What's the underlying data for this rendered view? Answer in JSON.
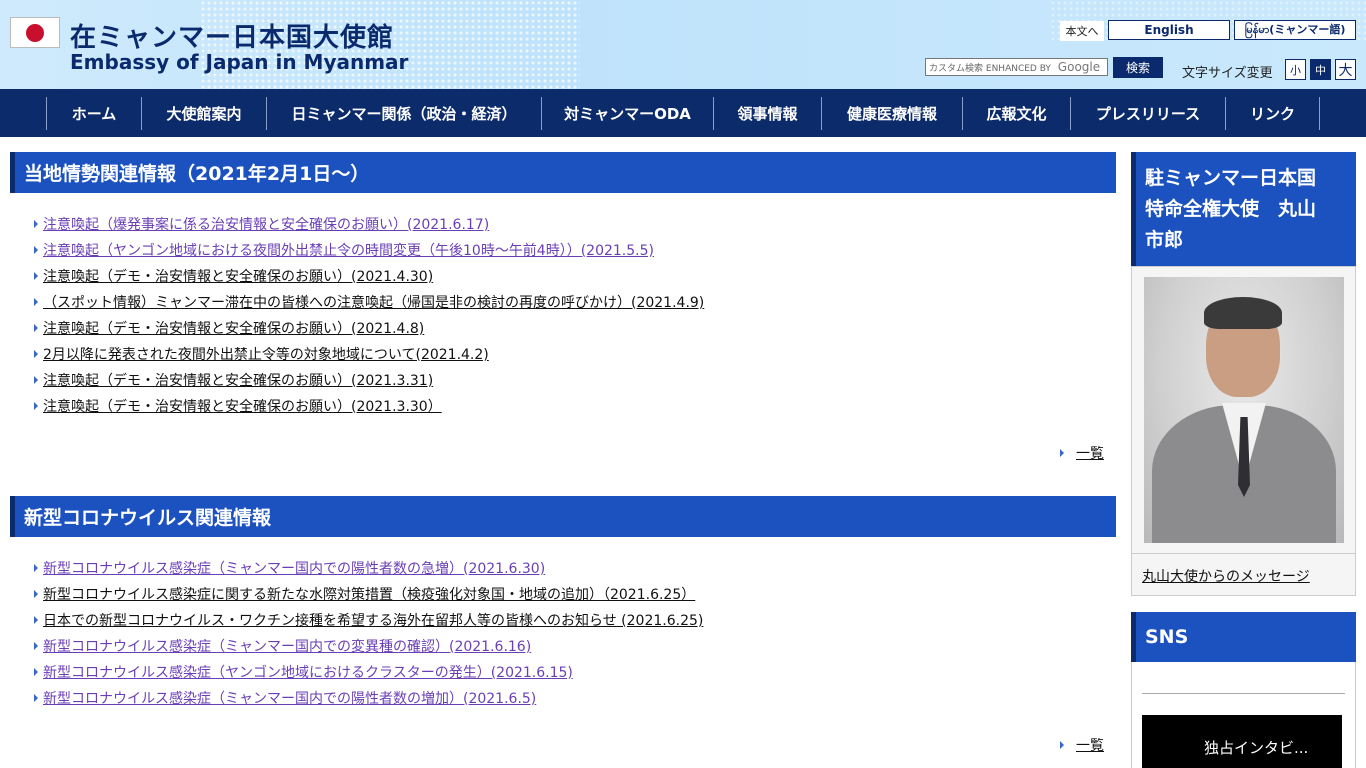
{
  "header": {
    "title_ja": "在ミャンマー日本国大使館",
    "title_en": "Embassy of Japan in Myanmar",
    "skip_link": "本文へ",
    "lang_english": "English",
    "lang_myanmar": "မြန်မာ(ミャンマー語)",
    "search_placeholder": "カスタム検索",
    "search_powered": "ENHANCED BY",
    "search_google": "Google",
    "search_button": "検索",
    "font_size_label": "文字サイズ変更",
    "font_small": "小",
    "font_medium": "中",
    "font_large": "大"
  },
  "nav": [
    "ホーム",
    "大使館案内",
    "日ミャンマー関係（政治・経済）",
    "対ミャンマーODA",
    "領事情報",
    "健康医療情報",
    "広報文化",
    "プレスリリース",
    "リンク"
  ],
  "section1": {
    "title": "当地情勢関連情報（2021年2月1日～）",
    "items": [
      "注意喚起（爆発事案に係る治安情報と安全確保のお願い）(2021.6.17)",
      "注意喚起（ヤンゴン地域における夜間外出禁止令の時間変更（午後10時～午前4時））(2021.5.5)",
      "注意喚起（デモ・治安情報と安全確保のお願い）(2021.4.30)",
      "（スポット情報）ミャンマー滞在中の皆様への注意喚起（帰国是非の検討の再度の呼びかけ）(2021.4.9)",
      "注意喚起（デモ・治安情報と安全確保のお願い）(2021.4.8)",
      "2月以降に発表された夜間外出禁止令等の対象地域について(2021.4.2)",
      "注意喚起（デモ・治安情報と安全確保のお願い）(2021.3.31)",
      "注意喚起（デモ・治安情報と安全確保のお願い）(2021.3.30）"
    ],
    "more": "一覧"
  },
  "section2": {
    "title": "新型コロナウイルス関連情報",
    "items": [
      "新型コロナウイルス感染症（ミャンマー国内での陽性者数の急増）(2021.6.30)",
      "新型コロナウイルス感染症に関する新たな水際対策措置（検疫強化対象国・地域の追加）（2021.6.25）",
      "日本での新型コロナウイルス・ワクチン接種を希望する海外在留邦人等の皆様へのお知らせ (2021.6.25)",
      "新型コロナウイルス感染症（ミャンマー国内での変異種の確認）(2021.6.16)",
      "新型コロナウイルス感染症（ヤンゴン地域におけるクラスターの発生）(2021.6.15)",
      "新型コロナウイルス感染症（ミャンマー国内での陽性者数の増加）(2021.6.5)"
    ],
    "more": "一覧"
  },
  "sidebar": {
    "ambassador_title_line1": "駐ミャンマー日本国",
    "ambassador_title_line2": "特命全権大使　丸山",
    "ambassador_title_line3": "市郎",
    "ambassador_link": "丸山大使からのメッセージ",
    "sns_title": "SNS",
    "video_caption": "独占インタビ..."
  }
}
